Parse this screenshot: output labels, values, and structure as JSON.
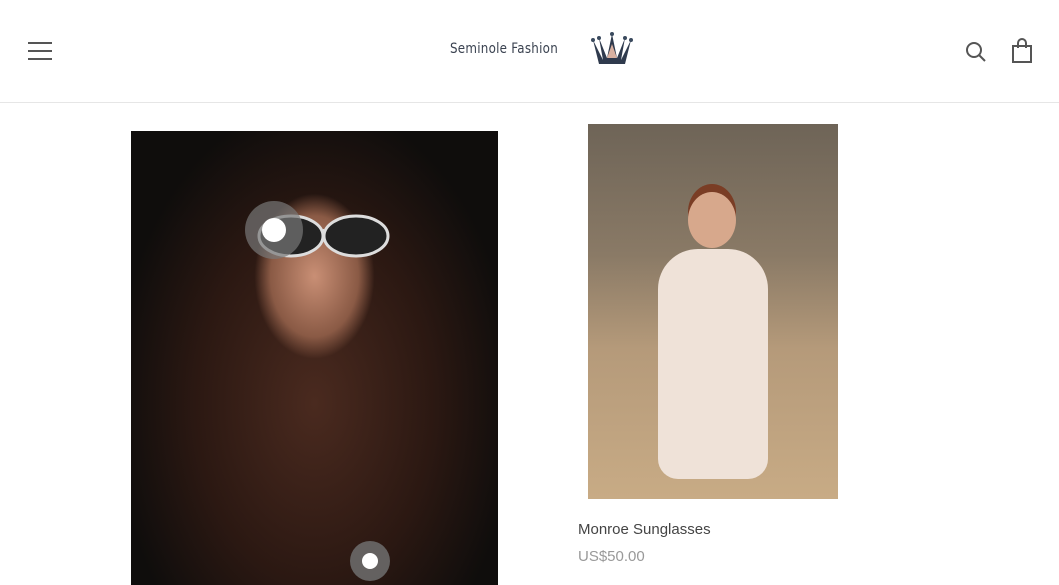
{
  "header": {
    "logo_text": "Seminole Fashion",
    "menu_icon": "hamburger-icon",
    "search_icon": "search-icon",
    "cart_icon": "shopping-bag-icon"
  },
  "products": [
    {
      "title": "",
      "price": ""
    },
    {
      "title": "Monroe Sunglasses",
      "price": "US$50.00"
    }
  ]
}
